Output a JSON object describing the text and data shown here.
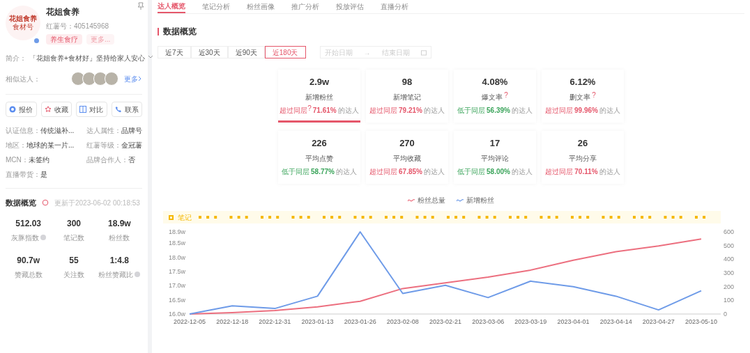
{
  "profile": {
    "logo": {
      "title": "花姐食养",
      "subtitle": "食材号"
    },
    "verified": true,
    "name": "花姐食养",
    "id_text": "红薯号：405145968",
    "tags": [
      {
        "label": "养生食疗",
        "kind": "primary"
      },
      {
        "label": "更多...",
        "kind": "more"
      }
    ],
    "intro_label": "简介：",
    "intro": "「花姐食养+食材好」坚持给家人安心",
    "similar_label": "相似达人：",
    "similar_more": "更多",
    "actions": [
      {
        "label": "报价"
      },
      {
        "label": "收藏"
      },
      {
        "label": "对比"
      },
      {
        "label": "联系"
      }
    ],
    "info": [
      {
        "label": "认证信息：",
        "value": "传统滋补..."
      },
      {
        "label": "达人属性：",
        "value": "品牌号"
      },
      {
        "label": "地区：",
        "value": "地球的某一片..."
      },
      {
        "label": "红薯等级：",
        "value": "金冠薯"
      },
      {
        "label": "MCN：",
        "value": "未签约"
      },
      {
        "label": "品牌合作人：",
        "value": "否"
      },
      {
        "label": "直播带货：",
        "value": "是"
      }
    ]
  },
  "overview": {
    "title": "数据概览",
    "updated": "更新于2023-06-02 00:18:53",
    "stats": [
      {
        "value": "512.03",
        "label": "灰豚指数",
        "help": true
      },
      {
        "value": "300",
        "label": "笔记数",
        "help": false
      },
      {
        "value": "18.9w",
        "label": "粉丝数",
        "help": false
      },
      {
        "value": "90.7w",
        "label": "赞藏总数",
        "help": false
      },
      {
        "value": "55",
        "label": "关注数",
        "help": false
      },
      {
        "value": "1:4.8",
        "label": "粉丝赞藏比",
        "help": true
      }
    ]
  },
  "tabs": [
    {
      "label": "达人概览",
      "selected": true
    },
    {
      "label": "笔记分析",
      "selected": false
    },
    {
      "label": "粉丝画像",
      "selected": false
    },
    {
      "label": "推广分析",
      "selected": false
    },
    {
      "label": "投放评估",
      "selected": false
    },
    {
      "label": "直播分析",
      "selected": false
    }
  ],
  "section_title": "数据概览",
  "ranges": [
    {
      "label": "近7天",
      "selected": false
    },
    {
      "label": "近30天",
      "selected": false
    },
    {
      "label": "近90天",
      "selected": false
    },
    {
      "label": "近180天",
      "selected": true
    }
  ],
  "date_range": {
    "start_placeholder": "开始日期",
    "separator": "→",
    "end_placeholder": "结束日期"
  },
  "cards": [
    {
      "value": "2.9w",
      "label": "新增粉丝",
      "compare_mark": "?",
      "selected": true,
      "compare": {
        "kind": "above",
        "prefix": "超过同层",
        "pct": "71.61%",
        "suffix": "的达人"
      }
    },
    {
      "value": "98",
      "label": "新增笔记",
      "selected": false,
      "compare": {
        "kind": "above",
        "prefix": "超过同层",
        "pct": "79.21%",
        "suffix": "的达人"
      }
    },
    {
      "value": "4.08%",
      "label": "爆文率",
      "label_mark": "?",
      "selected": false,
      "compare": {
        "kind": "below",
        "prefix": "低于同层",
        "pct": "56.39%",
        "suffix": "的达人"
      }
    },
    {
      "value": "6.12%",
      "label": "删文率",
      "label_mark": "?",
      "selected": false,
      "compare": {
        "kind": "above",
        "prefix": "超过同层",
        "pct": "99.96%",
        "suffix": "的达人"
      }
    },
    {
      "value": "226",
      "label": "平均点赞",
      "selected": false,
      "compare": {
        "kind": "below",
        "prefix": "低于同层",
        "pct": "58.77%",
        "suffix": "的达人"
      }
    },
    {
      "value": "270",
      "label": "平均收藏",
      "selected": false,
      "compare": {
        "kind": "above",
        "prefix": "超过同层",
        "pct": "67.85%",
        "suffix": "的达人"
      }
    },
    {
      "value": "17",
      "label": "平均评论",
      "selected": false,
      "compare": {
        "kind": "below",
        "prefix": "低于同层",
        "pct": "58.00%",
        "suffix": "的达人"
      }
    },
    {
      "value": "26",
      "label": "平均分享",
      "selected": false,
      "compare": {
        "kind": "above",
        "prefix": "超过同层",
        "pct": "70.11%",
        "suffix": "的达人"
      }
    }
  ],
  "notes_label": "笔记",
  "chart_data": {
    "type": "line",
    "categories": [
      "2022-12-05",
      "2022-12-18",
      "2022-12-31",
      "2023-01-13",
      "2023-01-26",
      "2023-02-08",
      "2023-02-21",
      "2023-03-06",
      "2023-03-19",
      "2023-04-01",
      "2023-04-14",
      "2023-04-27",
      "2023-05-10"
    ],
    "series": [
      {
        "name": "粉丝总量",
        "color": "#ec6f7f",
        "values": [
          16.0,
          16.05,
          16.12,
          16.25,
          16.45,
          16.9,
          17.1,
          17.3,
          17.55,
          17.9,
          18.2,
          18.4,
          18.65
        ]
      },
      {
        "name": "新增粉丝",
        "color": "#6e9be8",
        "axis": "y2",
        "values": [
          0,
          60,
          40,
          130,
          600,
          150,
          210,
          120,
          240,
          200,
          130,
          30,
          170
        ]
      }
    ],
    "ylim": [
      16.0,
      18.9
    ],
    "yticks": [
      {
        "value": 16.0,
        "label": "16.0w"
      },
      {
        "value": 16.5,
        "label": "16.5w"
      },
      {
        "value": 17.0,
        "label": "17.0w"
      },
      {
        "value": 17.5,
        "label": "17.5w"
      },
      {
        "value": 18.0,
        "label": "18.0w"
      },
      {
        "value": 18.5,
        "label": "18.5w"
      },
      {
        "value": 18.9,
        "label": "18.9w"
      }
    ],
    "y2lim": [
      0,
      600
    ],
    "y2ticks": [
      0,
      100,
      200,
      300,
      400,
      500,
      600
    ]
  }
}
